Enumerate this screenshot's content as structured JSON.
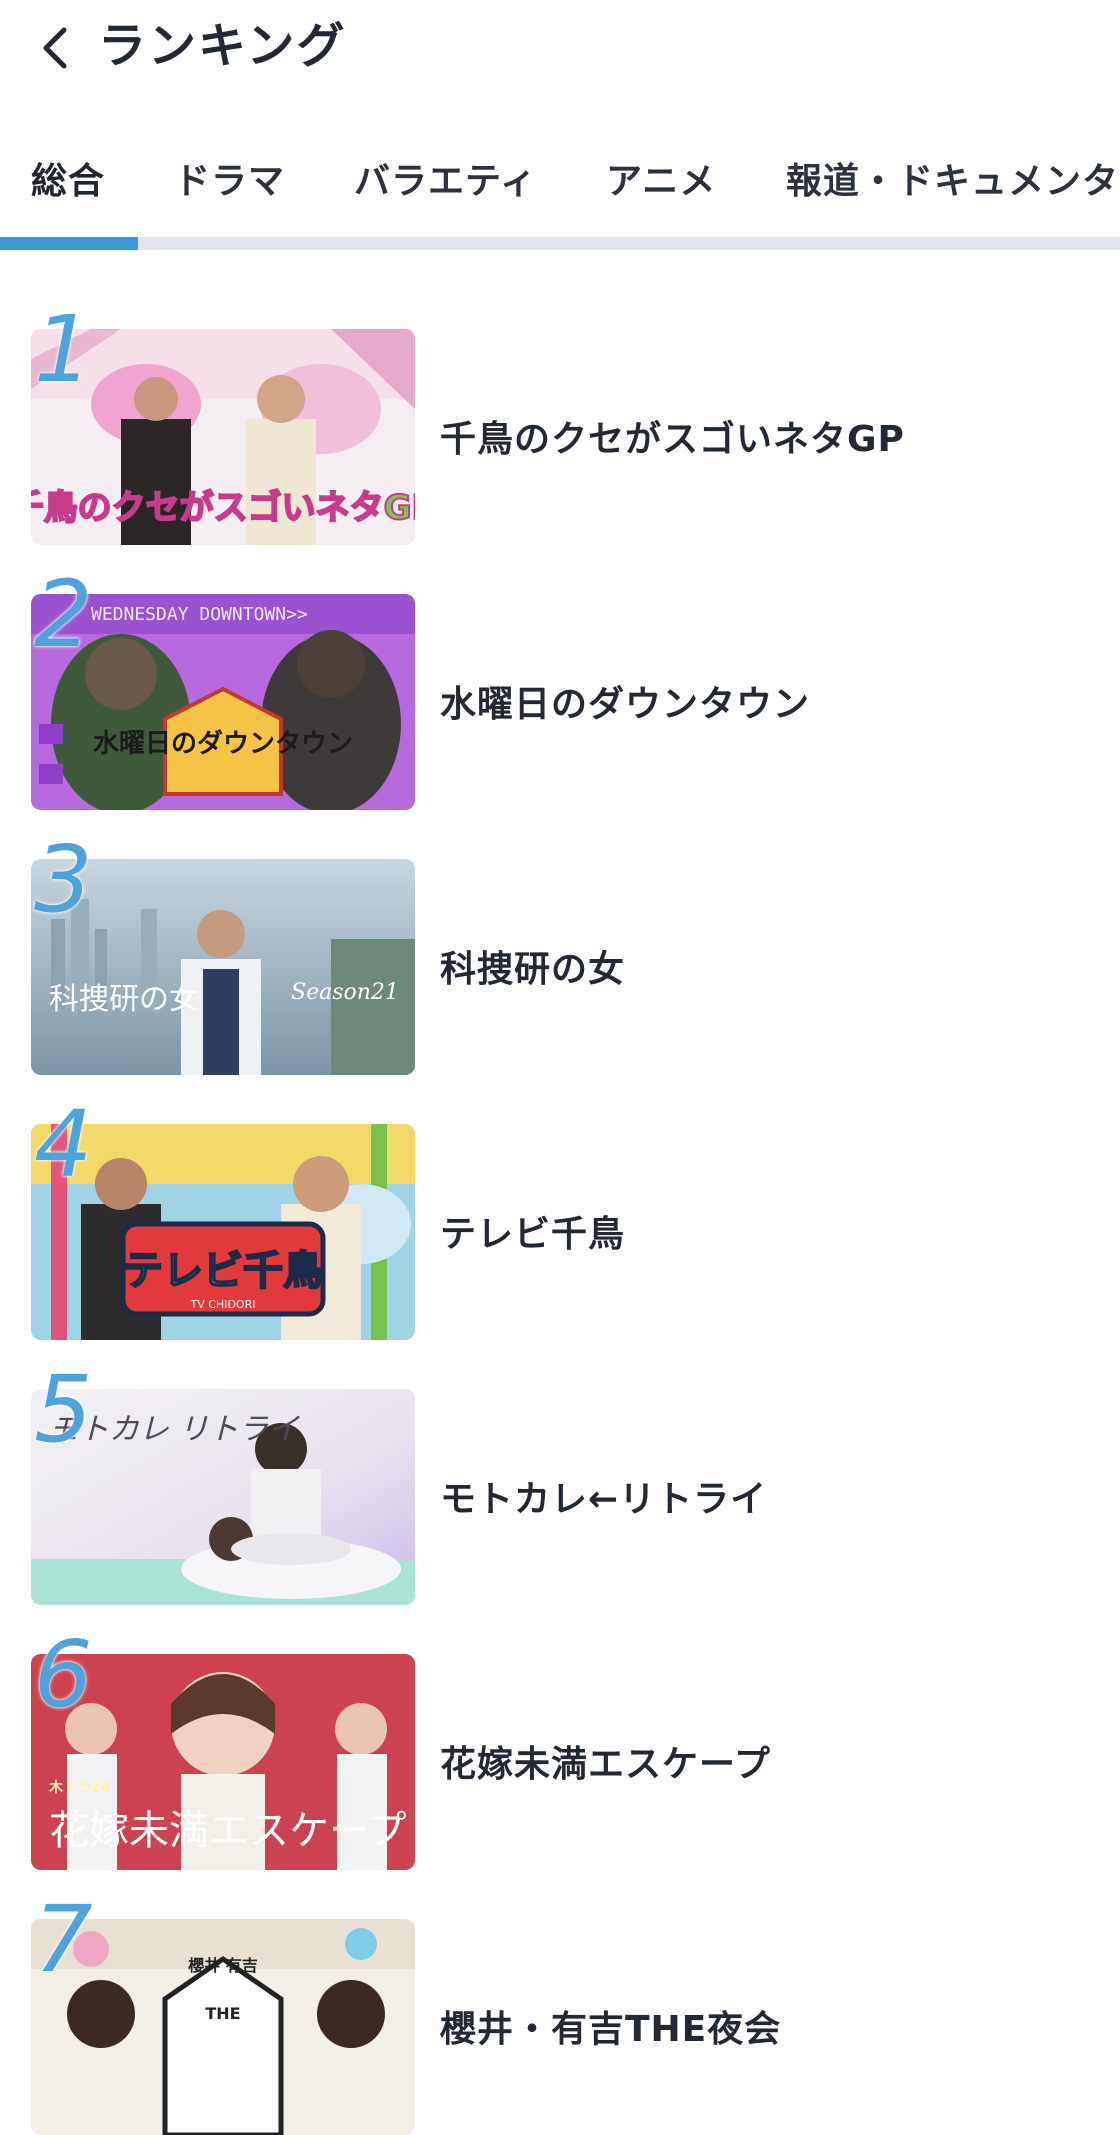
{
  "header": {
    "title": "ランキング",
    "back_icon": "chevron-left-icon"
  },
  "tabs": [
    {
      "label": "総合",
      "active": true
    },
    {
      "label": "ドラマ",
      "active": false
    },
    {
      "label": "バラエティ",
      "active": false
    },
    {
      "label": "アニメ",
      "active": false
    },
    {
      "label": "報道・ドキュメンタリー",
      "active": false
    }
  ],
  "colors": {
    "accent": "#3a9ad9",
    "rank_number": "#4fa3dd",
    "text": "#222834",
    "tab_track": "#e3e6ec"
  },
  "ranking": [
    {
      "rank": "1",
      "title": "千鳥のクセがスゴいネタGP",
      "thumb_text": "千鳥のクセがスゴいネタGP"
    },
    {
      "rank": "2",
      "title": "水曜日のダウンタウン",
      "thumb_text": "水曜日のダウンタウン",
      "thumb_banner": "WEDNESDAY DOWNTOWN>>"
    },
    {
      "rank": "3",
      "title": "科捜研の女",
      "thumb_text": "科捜研の女",
      "thumb_season": "Season21"
    },
    {
      "rank": "4",
      "title": "テレビ千鳥",
      "thumb_text": "テレビ千鳥",
      "thumb_sub": "TV CHIDORI"
    },
    {
      "rank": "5",
      "title": "モトカレ←リトライ",
      "thumb_text": "モトカレ リトライ"
    },
    {
      "rank": "6",
      "title": "花嫁未満エスケープ",
      "thumb_text": "花嫁未満エスケープ",
      "thumb_sub": "木ドラ24"
    },
    {
      "rank": "7",
      "title": "櫻井・有吉THE夜会",
      "thumb_text": "THE",
      "thumb_names": "櫻井 有吉"
    }
  ]
}
